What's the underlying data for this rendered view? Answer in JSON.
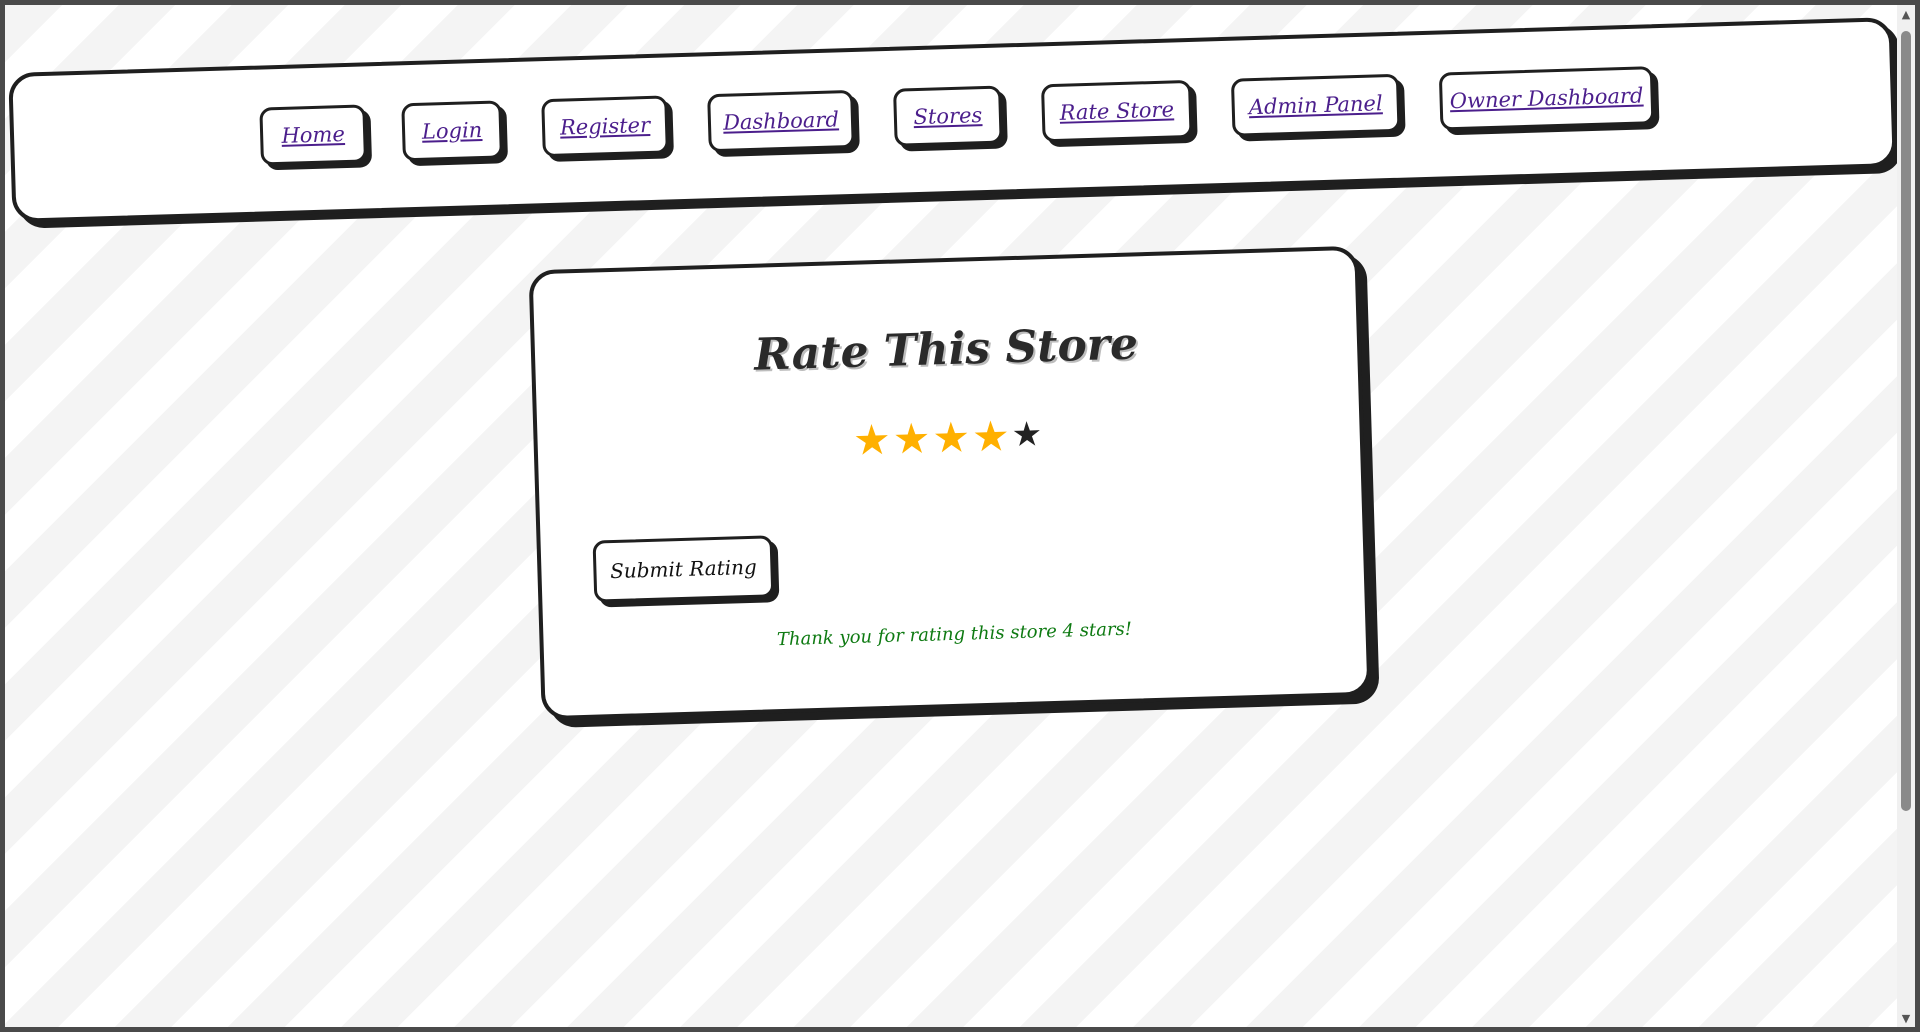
{
  "nav": {
    "items": [
      {
        "label": "Home"
      },
      {
        "label": "Login"
      },
      {
        "label": "Register"
      },
      {
        "label": "Dashboard"
      },
      {
        "label": "Stores"
      },
      {
        "label": "Rate Store"
      },
      {
        "label": "Admin Panel"
      },
      {
        "label": "Owner Dashboard"
      }
    ]
  },
  "card": {
    "title": "Rate This Store",
    "rating": {
      "value": 4,
      "max": 5,
      "filled_color": "#ffb000",
      "empty_color": "#222222",
      "glyph": "★"
    },
    "submit_label": "Submit Rating",
    "message": "Thank you for rating this store 4 stars!",
    "message_color": "#0e7a12"
  },
  "scrollbar": {
    "up_icon": "▲",
    "down_icon": "▼"
  }
}
